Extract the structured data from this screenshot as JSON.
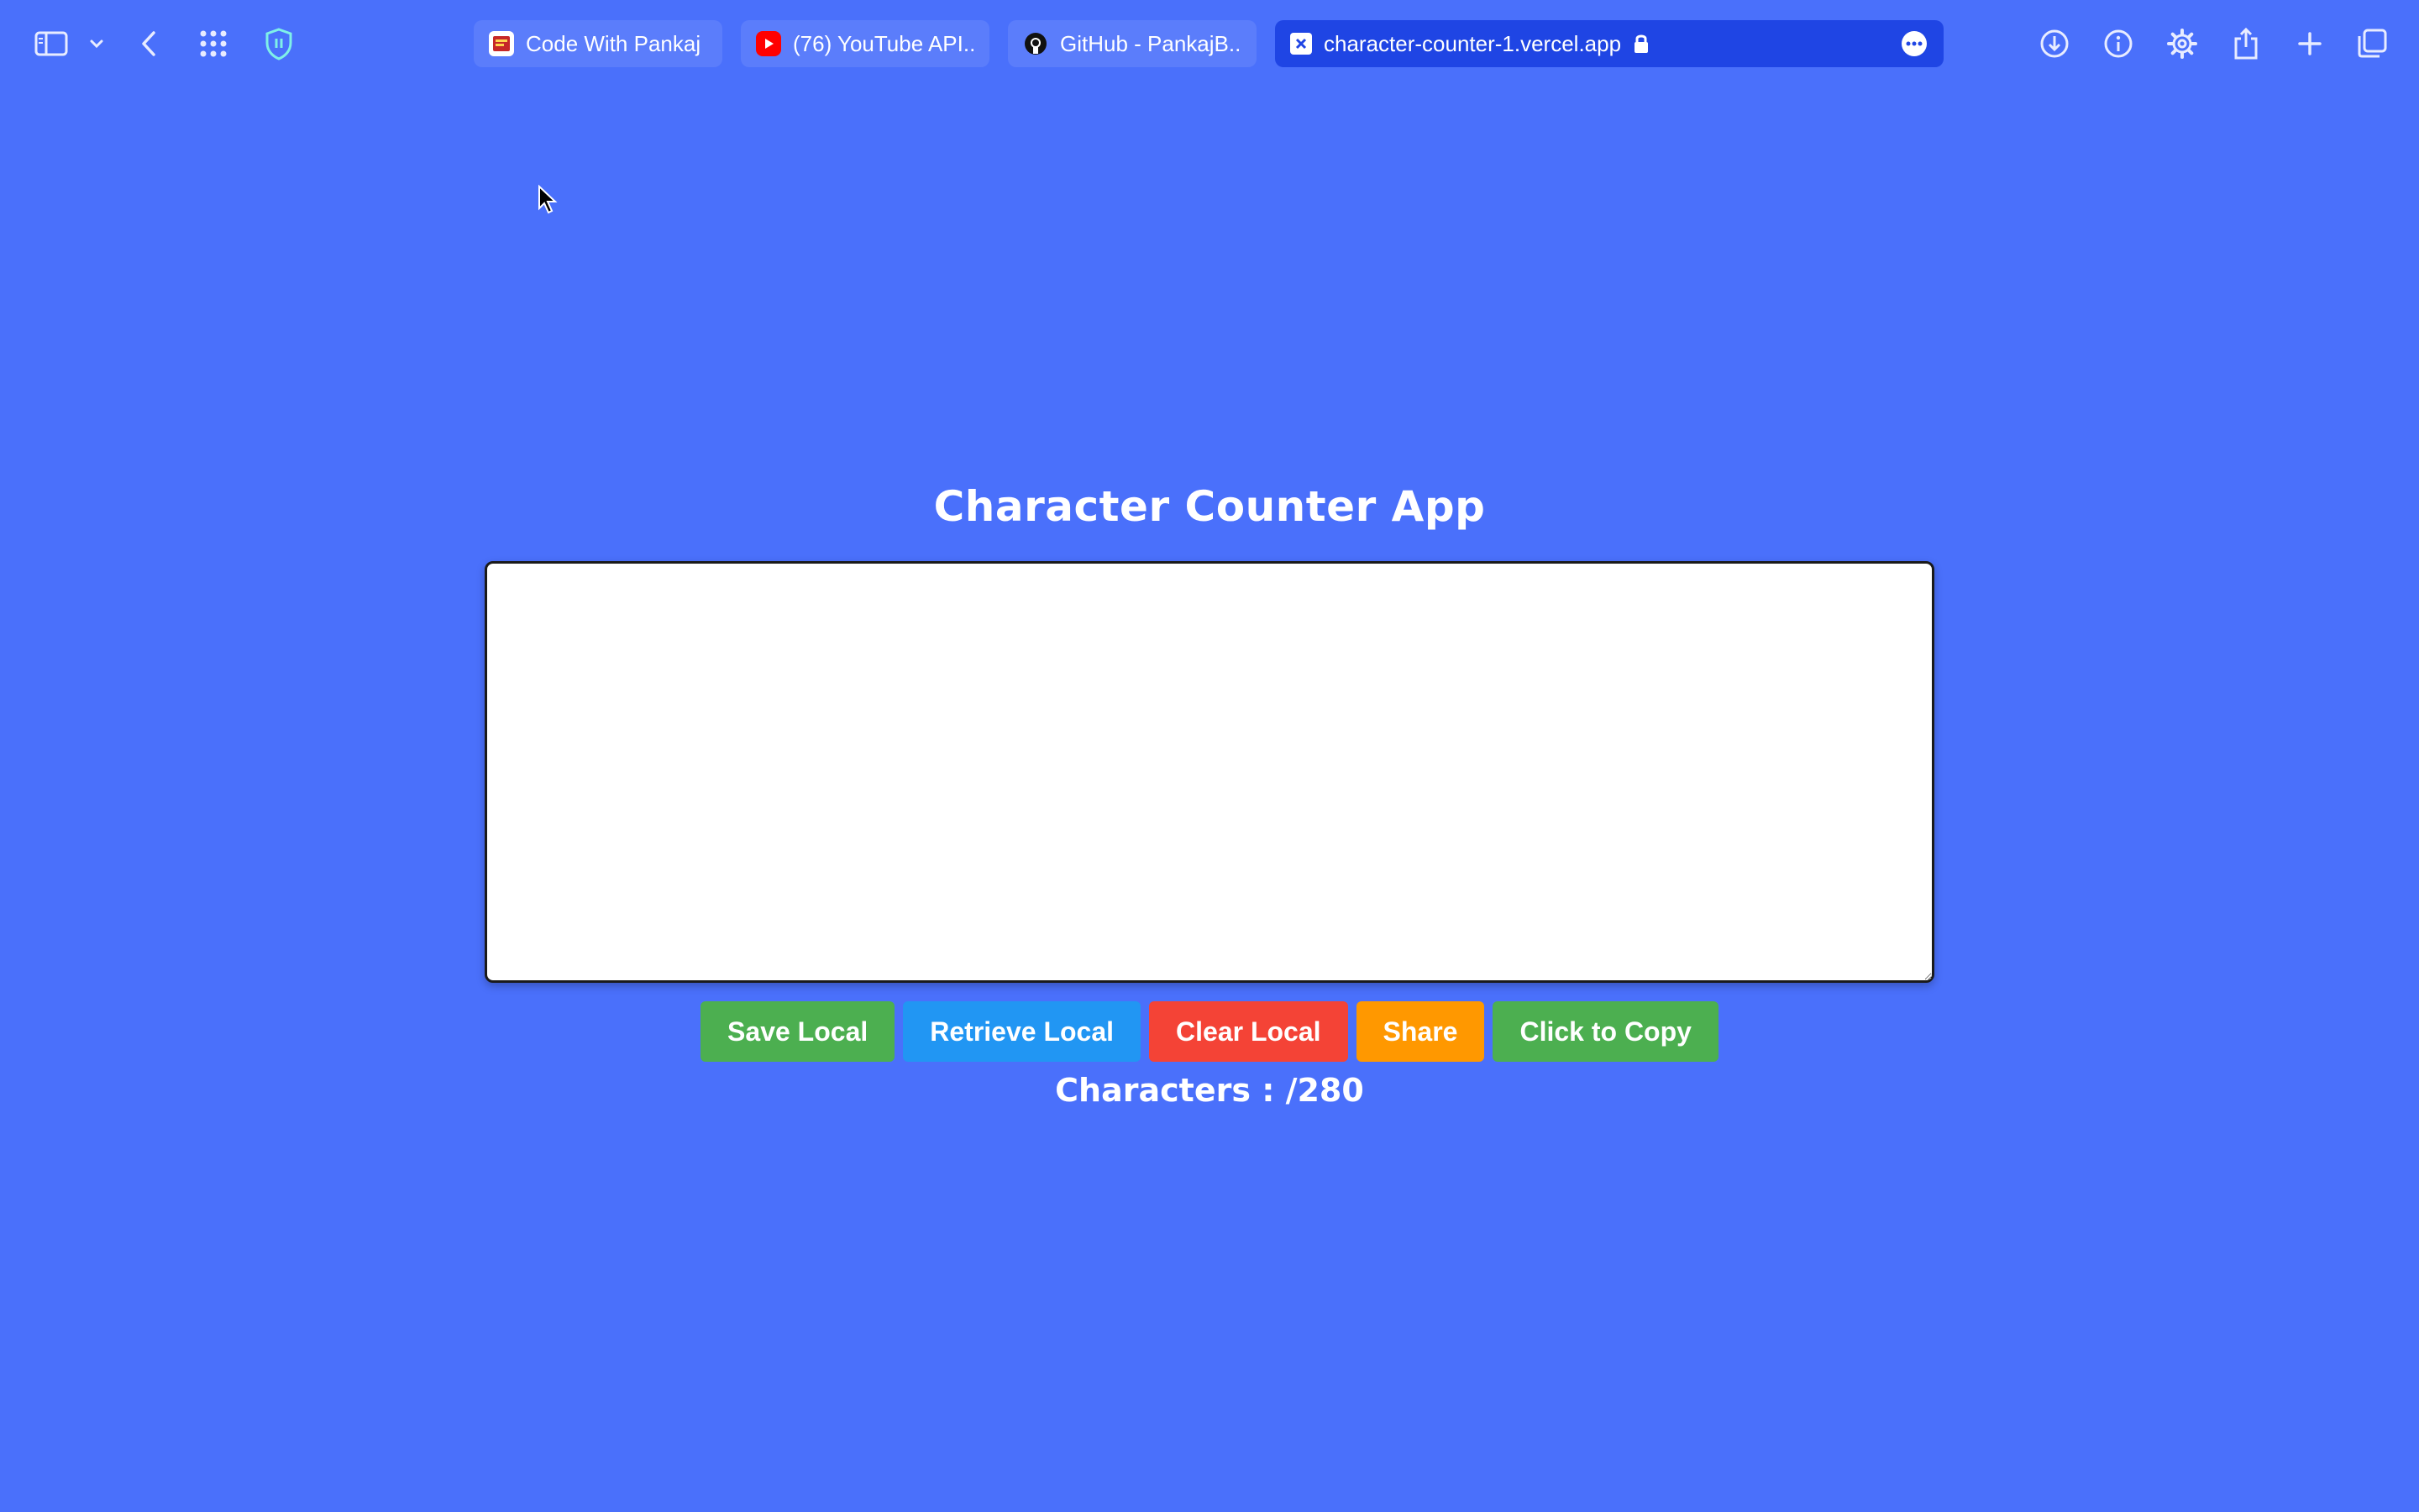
{
  "browser": {
    "tabs": [
      {
        "label": "Code With Pankaj",
        "favicon": "code-with-pankaj-favicon",
        "active": false
      },
      {
        "label": "(76) YouTube API...",
        "favicon": "youtube-favicon",
        "active": false
      },
      {
        "label": "GitHub - PankajB...",
        "favicon": "github-favicon",
        "active": false
      },
      {
        "label": "character-counter-1.vercel.app",
        "favicon": "vercel-favicon",
        "active": true
      }
    ],
    "toolbar_icons": {
      "left": [
        "sidebar-icon",
        "chevron-down-icon",
        "back-icon",
        "grid-icon",
        "shield-icon"
      ],
      "right": [
        "download-icon",
        "info-icon",
        "gear-icon",
        "share-icon",
        "plus-icon",
        "tabs-overview-icon"
      ]
    }
  },
  "app": {
    "title": "Character Counter App",
    "textarea": {
      "value": "",
      "placeholder": ""
    },
    "buttons": {
      "save": {
        "label": "Save Local",
        "color": "#4caf50"
      },
      "retrieve": {
        "label": "Retrieve Local",
        "color": "#2196f3"
      },
      "clear": {
        "label": "Clear Local",
        "color": "#f44336"
      },
      "share": {
        "label": "Share",
        "color": "#ff9800"
      },
      "copy": {
        "label": "Click to Copy",
        "color": "#4caf50"
      }
    },
    "counter_text": "Characters : /280"
  },
  "colors": {
    "page_background": "#4a70fb",
    "active_tab": "#1f45e4",
    "inactive_tab": "#5b7dfb"
  }
}
